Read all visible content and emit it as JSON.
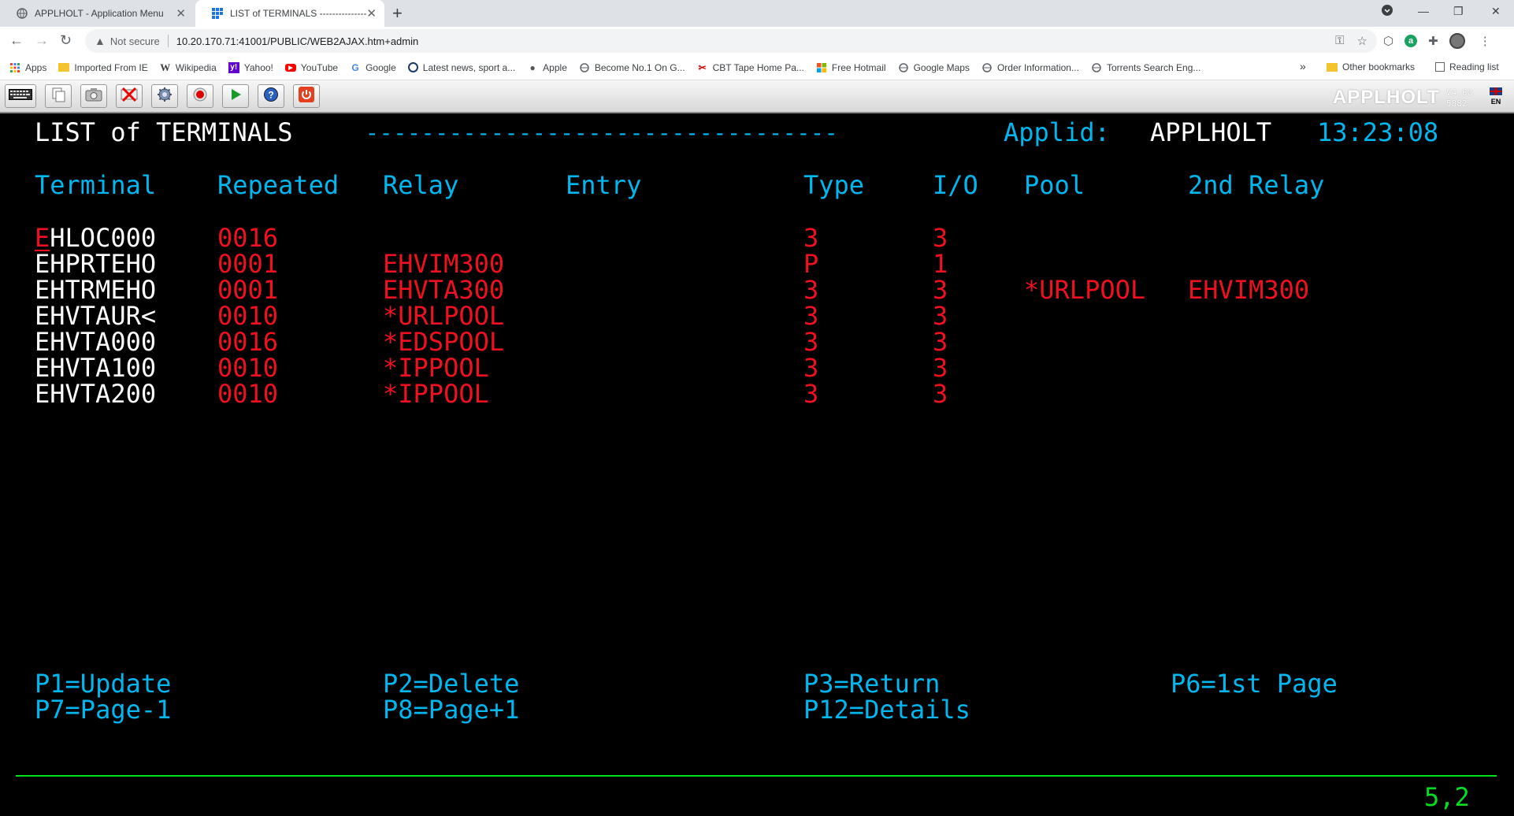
{
  "browser": {
    "tabs": [
      {
        "title": "APPLHOLT - Application Menu",
        "active": false
      },
      {
        "title": "LIST of TERMINALS ---------------",
        "active": true
      }
    ],
    "security_label": "Not secure",
    "url": "10.20.170.71:41001/PUBLIC/WEB2AJAX.htm+admin",
    "bookmarks": [
      {
        "label": "Apps",
        "icon": "apps-grid-icon"
      },
      {
        "label": "Imported From IE",
        "icon": "folder-icon"
      },
      {
        "label": "Wikipedia",
        "icon": "wikipedia-icon"
      },
      {
        "label": "Yahoo!",
        "icon": "yahoo-icon"
      },
      {
        "label": "YouTube",
        "icon": "youtube-icon"
      },
      {
        "label": "Google",
        "icon": "google-icon"
      },
      {
        "label": "Latest news, sport a...",
        "icon": "news-icon"
      },
      {
        "label": "Apple",
        "icon": "apple-icon"
      },
      {
        "label": "Become No.1 On G...",
        "icon": "globe-icon"
      },
      {
        "label": "CBT Tape Home Pa...",
        "icon": "cbt-icon"
      },
      {
        "label": "Free Hotmail",
        "icon": "windows-icon"
      },
      {
        "label": "Google Maps",
        "icon": "globe-icon"
      },
      {
        "label": "Order Information...",
        "icon": "globe-icon"
      },
      {
        "label": "Torrents Search Eng...",
        "icon": "globe-icon"
      }
    ],
    "overflow": "»",
    "other_bookmarks": "Other bookmarks",
    "reading_list": "Reading list"
  },
  "app": {
    "brand": "APPLHOLT",
    "version_line1": "V4.60",
    "version_line2": "5882",
    "lang": "EN"
  },
  "screen": {
    "title": "LIST of TERMINALS",
    "dashes": "----------------------------------",
    "applid_label": "Applid:",
    "applid_value": "APPLHOLT",
    "time": "13:23:08",
    "headers": {
      "terminal": "Terminal",
      "repeated": "Repeated",
      "relay": "Relay",
      "entry": "Entry",
      "type": "Type",
      "io": "I/O",
      "pool": "Pool",
      "relay2": "2nd Relay"
    },
    "rows": [
      {
        "terminal": "EHLOC000",
        "repeated": "0016",
        "relay": "",
        "entry": "",
        "type": "3",
        "io": "3",
        "pool": "",
        "relay2": ""
      },
      {
        "terminal": "EHPRTEHO",
        "repeated": "0001",
        "relay": "EHVIM300",
        "entry": "",
        "type": "P",
        "io": "1",
        "pool": "",
        "relay2": ""
      },
      {
        "terminal": "EHTRMEHO",
        "repeated": "0001",
        "relay": "EHVTA300",
        "entry": "",
        "type": "3",
        "io": "3",
        "pool": "*URLPOOL",
        "relay2": "EHVIM300"
      },
      {
        "terminal": "EHVTAUR<",
        "repeated": "0010",
        "relay": "*URLPOOL",
        "entry": "",
        "type": "3",
        "io": "3",
        "pool": "",
        "relay2": ""
      },
      {
        "terminal": "EHVTA000",
        "repeated": "0016",
        "relay": "*EDSPOOL",
        "entry": "",
        "type": "3",
        "io": "3",
        "pool": "",
        "relay2": ""
      },
      {
        "terminal": "EHVTA100",
        "repeated": "0010",
        "relay": "*IPPOOL",
        "entry": "",
        "type": "3",
        "io": "3",
        "pool": "",
        "relay2": ""
      },
      {
        "terminal": "EHVTA200",
        "repeated": "0010",
        "relay": "*IPPOOL",
        "entry": "",
        "type": "3",
        "io": "3",
        "pool": "",
        "relay2": ""
      }
    ],
    "pfkeys": {
      "p1": "P1=Update",
      "p2": "P2=Delete",
      "p3": "P3=Return",
      "p6": "P6=1st Page",
      "p7": "P7=Page-1",
      "p8": "P8=Page+1",
      "p12": "P12=Details"
    },
    "cursor_position": "5,2"
  }
}
